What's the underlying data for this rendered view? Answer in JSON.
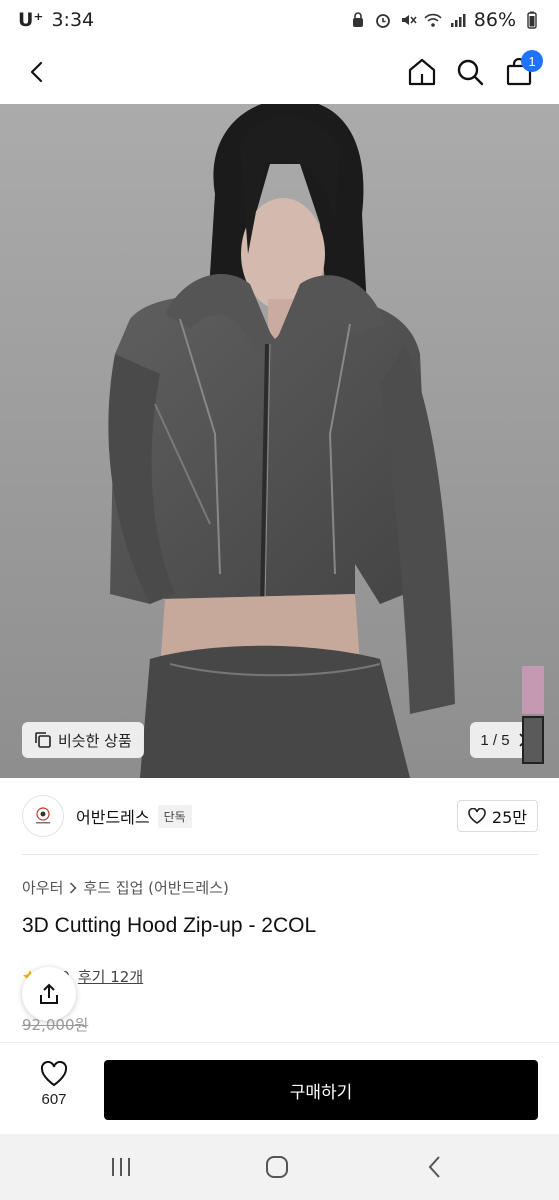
{
  "status_bar": {
    "carrier": "U⁺",
    "time": "3:34",
    "battery": "86%",
    "icons": [
      "alarm-icon",
      "mute-icon",
      "wifi-icon",
      "signal-icon",
      "battery-icon"
    ]
  },
  "header": {
    "cart_count": "1",
    "icons": [
      "back-icon",
      "home-icon",
      "search-icon",
      "shopping-bag-icon"
    ]
  },
  "gallery": {
    "similar_label": "비슷한 상품",
    "page_indicator": "1 / 5",
    "current_page": 1,
    "total_pages": 5
  },
  "brand": {
    "name": "어반드레스",
    "tag": "단독",
    "likes": "25만"
  },
  "product": {
    "breadcrumb": [
      "아우터",
      "후드 집업 (어반드레스)"
    ],
    "title": "3D Cutting Hood Zip-up - 2COL",
    "rating": "5.0",
    "review_label": "후기 12개",
    "original_price": "92,000원"
  },
  "purchase_bar": {
    "wish_count": "607",
    "buy_label": "구매하기"
  },
  "colors": {
    "accent": "#1e73ff",
    "buy_button": "#000000",
    "star": "#f5b301"
  }
}
